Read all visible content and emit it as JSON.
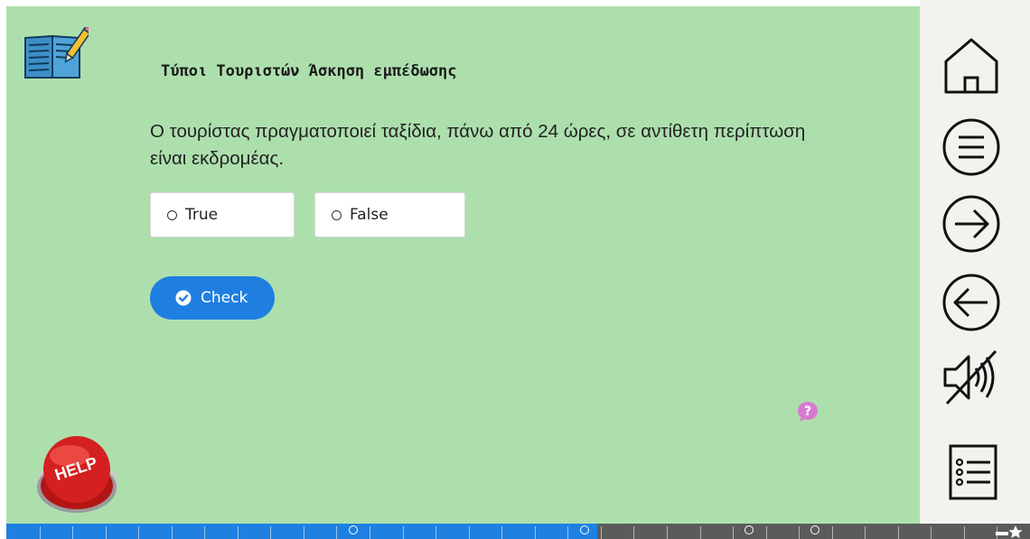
{
  "exercise": {
    "title": "Τύποι Τουριστών Άσκηση εμπέδωσης",
    "question": "Ο τουρίστας πραγματοποιεί ταξίδια, πάνω από 24 ώρες, σε αντίθετη περίπτωση είναι εκδρομέας.",
    "options": [
      {
        "label": "True"
      },
      {
        "label": "False"
      }
    ],
    "check_label": "Check"
  },
  "help": {
    "label": "HELP"
  },
  "sidebar": {
    "items": [
      {
        "icon": "home-icon"
      },
      {
        "icon": "menu-icon"
      },
      {
        "icon": "arrow-right-icon"
      },
      {
        "icon": "arrow-left-icon"
      },
      {
        "icon": "sound-muted-icon"
      },
      {
        "icon": "list-icon"
      }
    ]
  },
  "progress": {
    "completed_fraction": 0.577,
    "total_segments": 31,
    "marked_segments": [
      10,
      17,
      22,
      24
    ]
  },
  "colors": {
    "stage": "#addfad",
    "sidebar": "#f4f2ee",
    "accent": "#1f7fe0",
    "progress_fill": "#1e80e1",
    "progress_track": "#5b5b5b",
    "help_red": "#d42020",
    "hint_pink": "#d87ad0"
  }
}
